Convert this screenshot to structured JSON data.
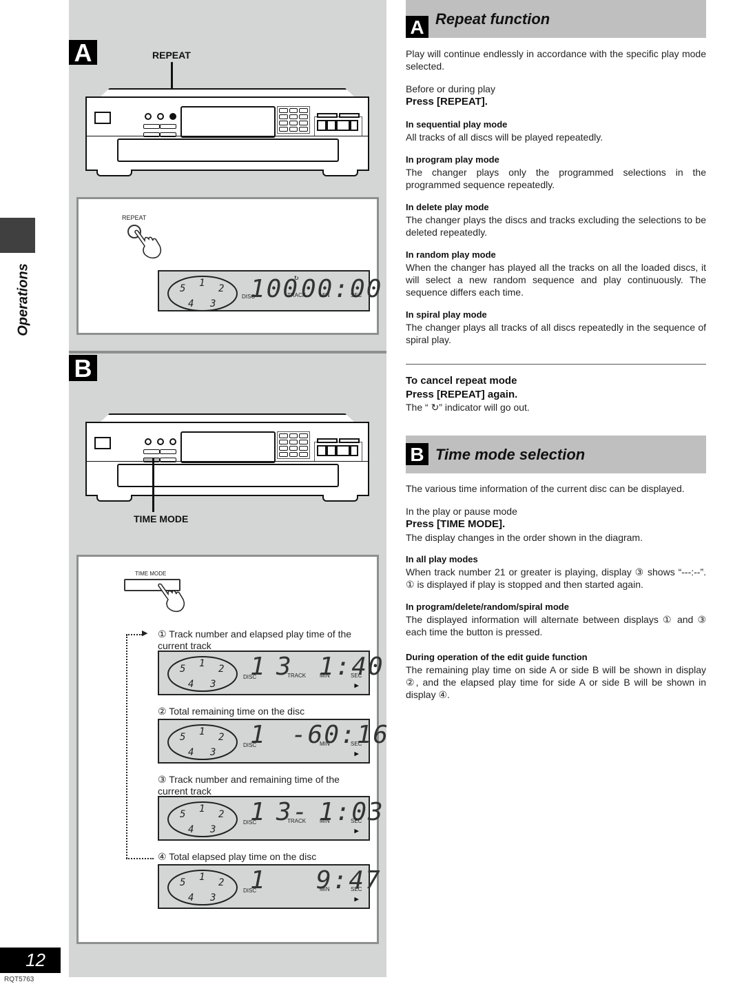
{
  "sidebar": {
    "section_label": "Operations",
    "page_number": "12",
    "doc_code": "RQT5763"
  },
  "left": {
    "panel_a": {
      "letter": "A",
      "callout": "REPEAT",
      "button_label": "REPEAT",
      "lcd": {
        "disc": "100",
        "time": "00:00",
        "repeat_indicator": "↻",
        "tags": {
          "disc": "DISC",
          "track": "TRACK",
          "min": "MIN",
          "sec": "SEC"
        }
      }
    },
    "panel_b": {
      "letter": "B",
      "callout": "TIME MODE",
      "button_label": "TIME MODE",
      "displays": [
        {
          "caption": "① Track number and elapsed play time of the current track",
          "disc": "1",
          "track": "3",
          "time": "1:40",
          "show_track": true
        },
        {
          "caption": "② Total remaining time on the disc",
          "disc": "1",
          "track": "",
          "time": "-60:16",
          "show_track": false
        },
        {
          "caption": "③ Track number and remaining time of the current track",
          "disc": "1",
          "track": "3-",
          "time": "1:03",
          "show_track": true
        },
        {
          "caption": "④ Total elapsed play time on the disc",
          "disc": "1",
          "track": "",
          "time": "9:47",
          "show_track": false
        }
      ],
      "lcd_tags": {
        "disc": "DISC",
        "track": "TRACK",
        "min": "MIN",
        "sec": "SEC",
        "play": "▶"
      }
    }
  },
  "right": {
    "section_a": {
      "letter": "A",
      "title": "Repeat function",
      "intro": "Play will continue endlessly in accordance with the specific play mode selected.",
      "when": "Before or during play",
      "press": "Press [REPEAT].",
      "modes": [
        {
          "heading": "In sequential play mode",
          "text": "All tracks of all discs will be played repeatedly."
        },
        {
          "heading": "In program play mode",
          "text": "The changer plays only the programmed selections in the programmed sequence repeatedly."
        },
        {
          "heading": "In delete play mode",
          "text": "The changer plays the discs and tracks excluding the selections to be deleted repeatedly."
        },
        {
          "heading": "In random play mode",
          "text": "When the changer has played all the tracks on all the loaded discs, it will select a new random sequence and play continuously. The sequence differs each time."
        },
        {
          "heading": "In spiral play mode",
          "text": "The changer plays all tracks of all discs repeatedly in the sequence of spiral play."
        }
      ],
      "cancel_heading": "To cancel repeat mode",
      "cancel_press": "Press [REPEAT] again.",
      "cancel_note": "The “ ↻” indicator will go out."
    },
    "section_b": {
      "letter": "B",
      "title": "Time mode selection",
      "intro": "The various time information of the current disc can be displayed.",
      "when": "In the play or pause mode",
      "press": "Press [TIME MODE].",
      "press_note": "The display changes in the order shown in the diagram.",
      "notes": [
        {
          "heading": "In all play modes",
          "text": "When track number 21 or greater is playing, display ③ shows “---:--”. ① is displayed if play is stopped and then started again."
        },
        {
          "heading": "In program/delete/random/spiral mode",
          "text": "The displayed information will alternate between displays ① and ③ each time the button is pressed."
        },
        {
          "heading": "During operation of the edit guide function",
          "text": "The remaining play time on side A or side B will be shown in display ②, and the elapsed play time for side A or side B will be shown in display ④."
        }
      ]
    }
  }
}
